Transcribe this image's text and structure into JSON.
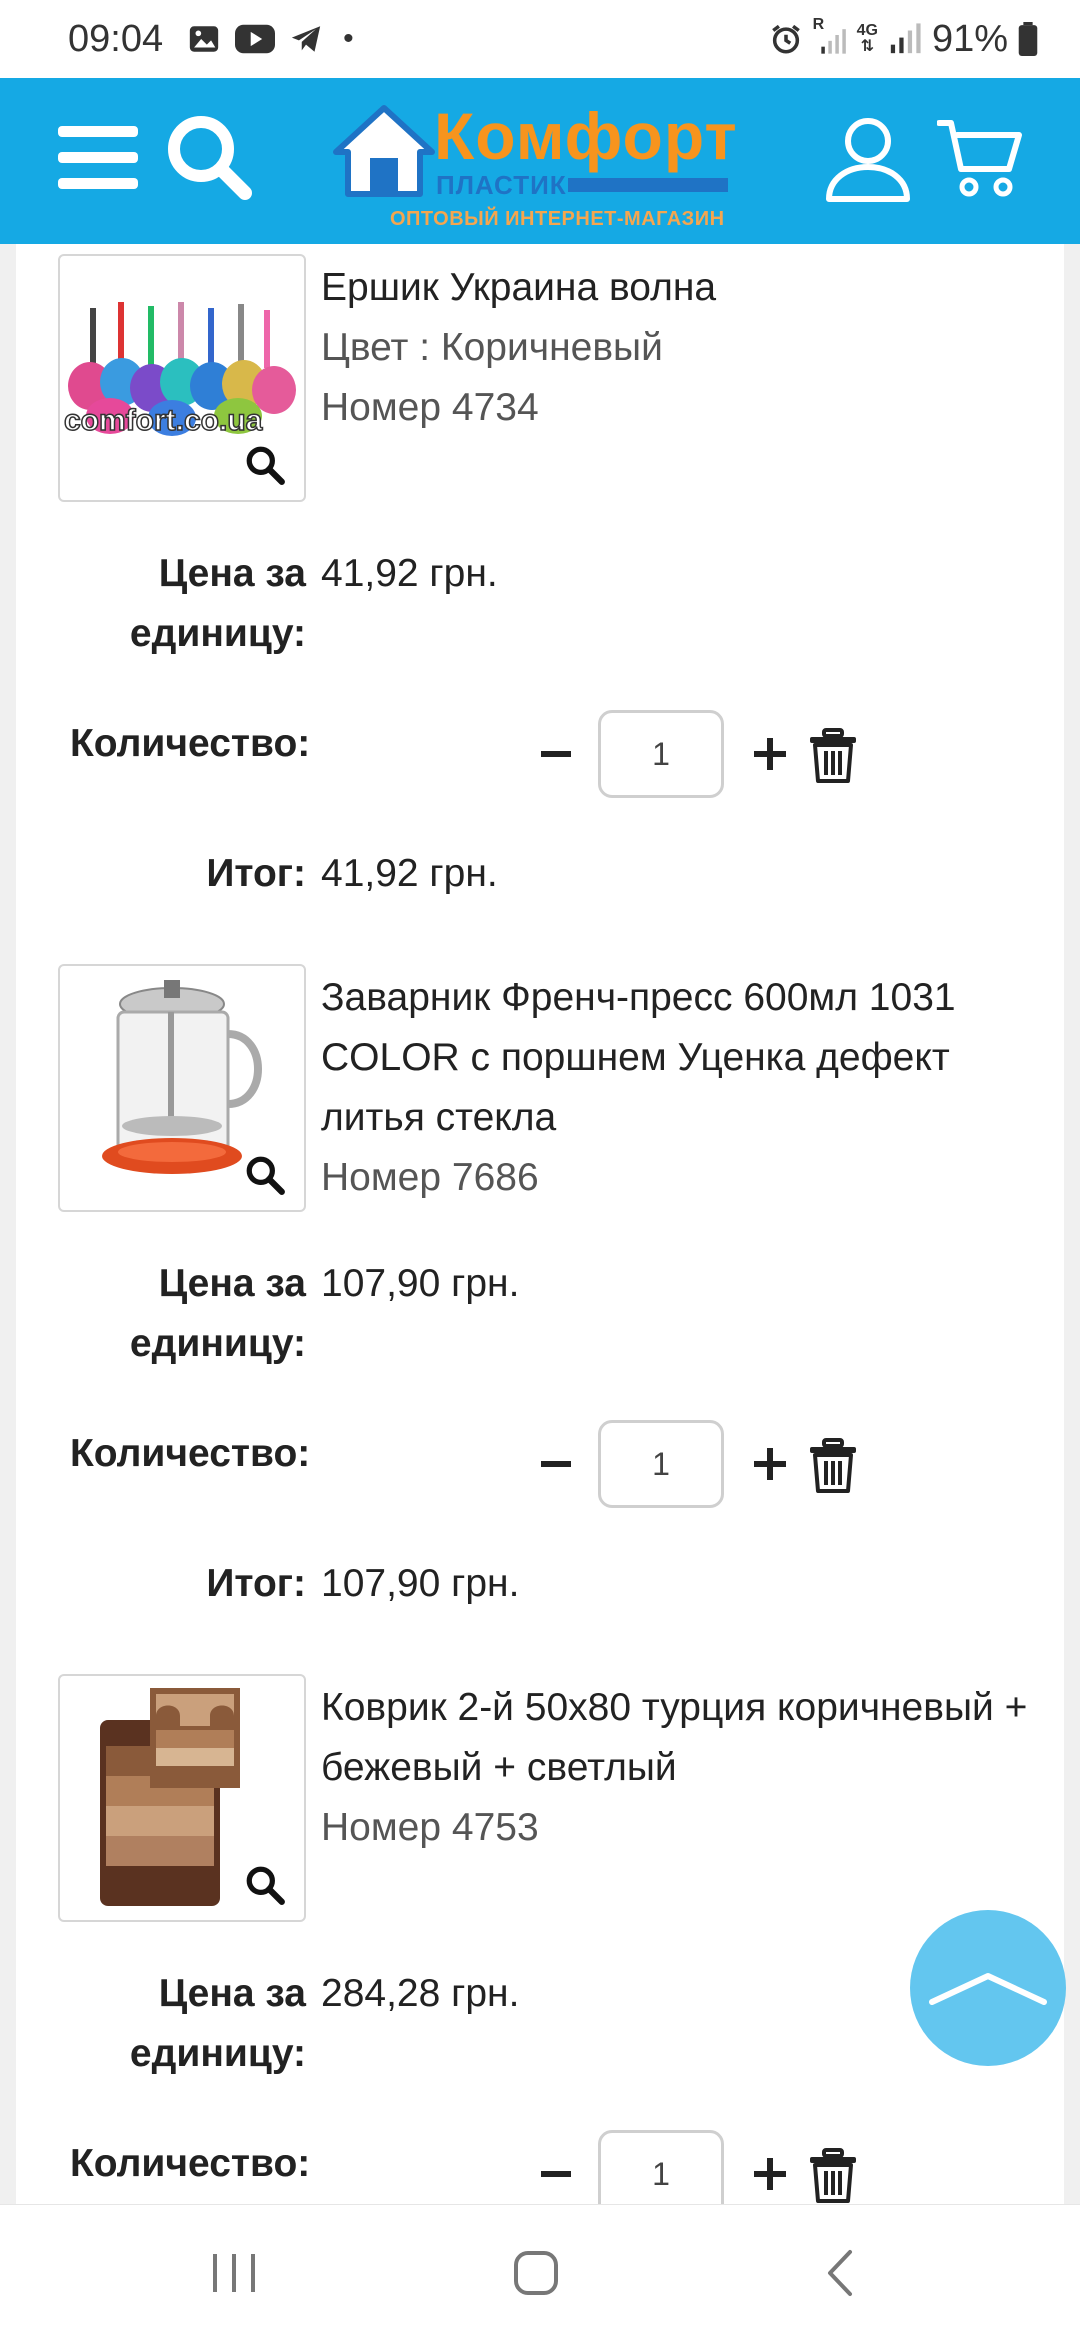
{
  "status_bar": {
    "time": "09:04",
    "left_icons": [
      "gallery-icon",
      "youtube-icon",
      "telegram-icon",
      "dot-icon"
    ],
    "right_icons": [
      "alarm-icon",
      "signal-roaming-icon",
      "4g-icon",
      "signal-icon",
      "battery-icon"
    ],
    "network_r": "R",
    "network_4g": "4G",
    "battery": "91%"
  },
  "header": {
    "logo_title": "Комфорт",
    "logo_subtitle": "ПЛАСТИК",
    "logo_tagline": "ОПТОВЫЙ ИНТЕРНЕТ-МАГАЗИН",
    "icons": [
      "menu-icon",
      "search-icon",
      "user-icon",
      "cart-icon"
    ],
    "brand_color": "#15a9e4",
    "accent_color": "#f7941d"
  },
  "labels": {
    "price_line1": "Цена за",
    "price_line2": "единицу:",
    "quantity": "Количество:",
    "total": "Итог:"
  },
  "cart_items": [
    {
      "title": "Ершик Украина волна",
      "color": "Цвет : Коричневый",
      "number": "Номер 4734",
      "image_watermark": "comfort.co.ua",
      "unit_price": "41,92 грн.",
      "quantity": "1",
      "total": "41,92 грн."
    },
    {
      "title": "Заварник Френч-пресс 600мл 1031 COLOR с поршнем Уценка дефект литья стекла",
      "number": "Номер 7686",
      "unit_price": "107,90 грн.",
      "quantity": "1",
      "total": "107,90 грн."
    },
    {
      "title": "Коврик 2-й 50х80 турция коричневый + бежевый + светлый",
      "number": "Номер 4753",
      "unit_price": "284,28 грн.",
      "quantity": "1"
    }
  ],
  "nav": {
    "icons": [
      "recent-apps-icon",
      "home-icon",
      "back-icon"
    ]
  }
}
